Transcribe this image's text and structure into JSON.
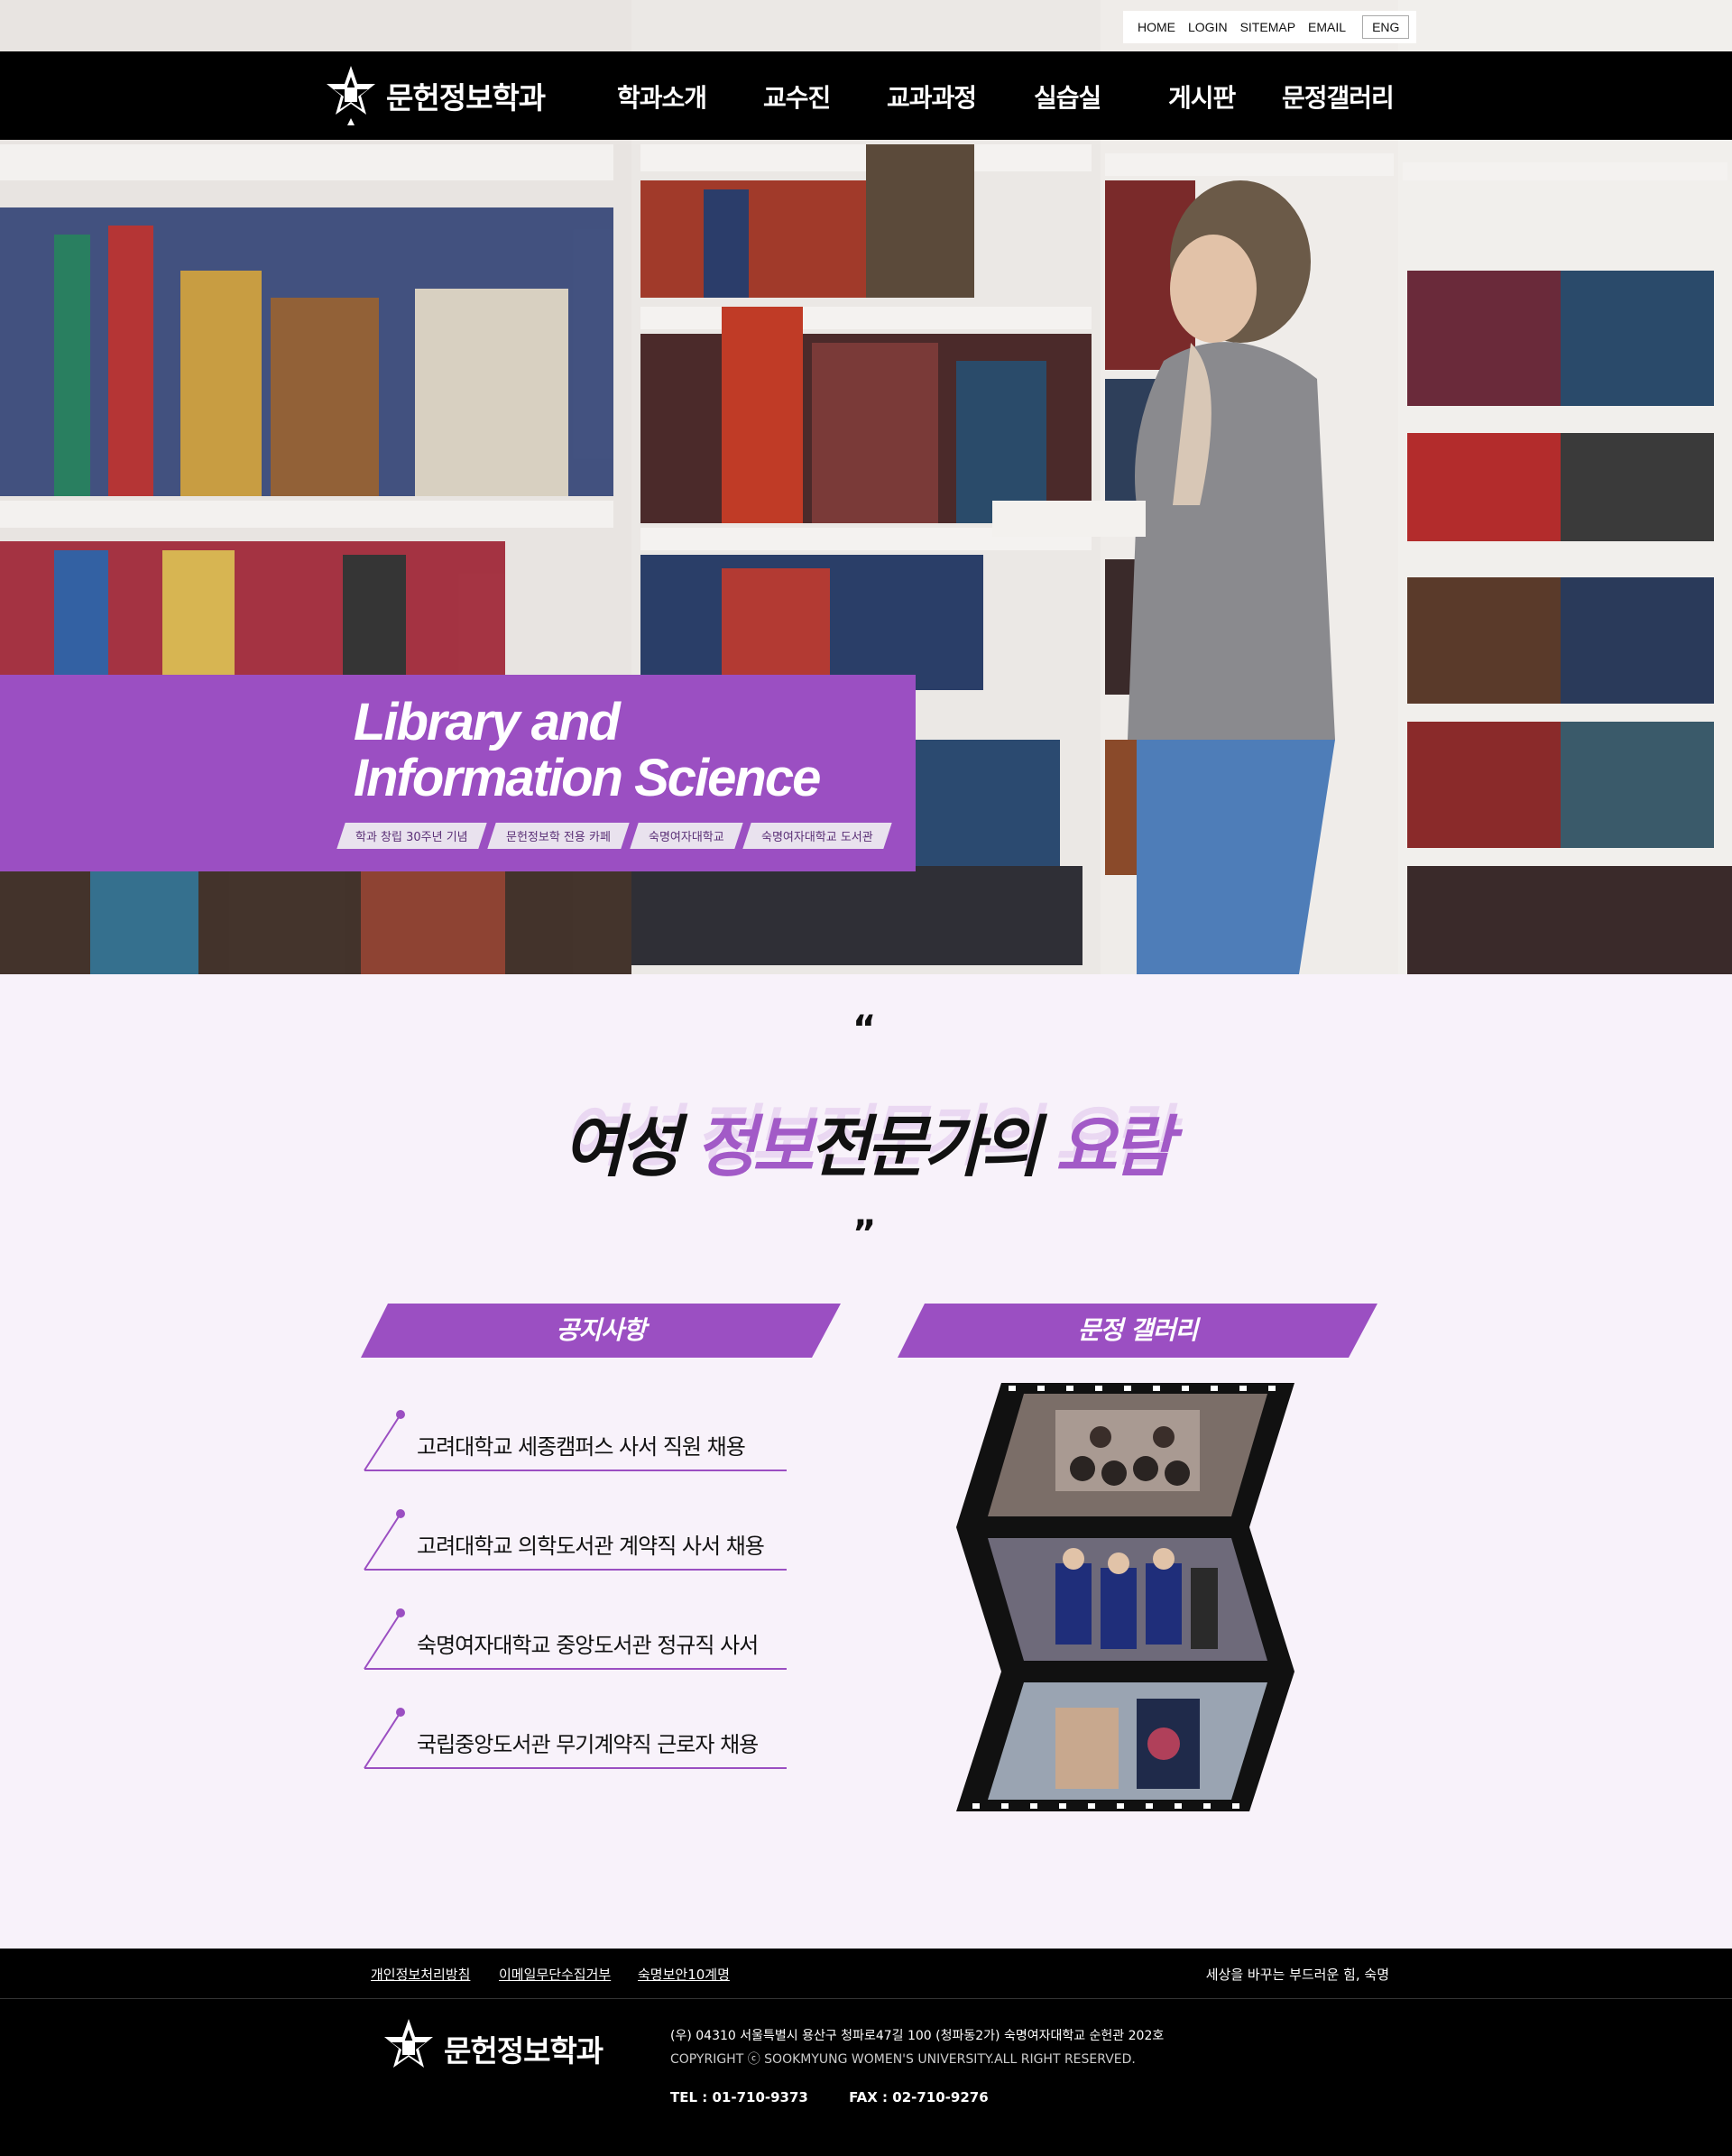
{
  "topbar": {
    "links": [
      "HOME",
      "LOGIN",
      "SITEMAP",
      "EMAIL"
    ],
    "lang": "ENG"
  },
  "nav": {
    "logo": "문헌정보학과",
    "items": [
      "학과소개",
      "교수진",
      "교과과정",
      "실습실",
      "게시판",
      "문정갤러리"
    ]
  },
  "hero": {
    "title_line1": "Library and",
    "title_line2": "Information Science",
    "links": [
      "학과 창립 30주년 기념",
      "문헌정보학 전용 카페",
      "숙명여자대학교",
      "숙명여자대학교 도서관"
    ]
  },
  "slogan": {
    "quote_open": "“",
    "quote_close": "”",
    "part1": "여성 ",
    "part2": "정보",
    "part3": "전문가의 ",
    "part4": "요람"
  },
  "notice": {
    "title": "공지사항",
    "items": [
      "고려대학교 세종캠퍼스 사서 직원 채용",
      "고려대학교 의학도서관 계약직 사서 채용",
      "숙명여자대학교 중앙도서관 정규직 사서",
      "국립중앙도서관 무기계약직 근로자 채용"
    ]
  },
  "gallery": {
    "title": "문정 갤러리"
  },
  "footer": {
    "links": [
      "개인정보처리방침",
      "이메일무단수집거부",
      "숙명보안10계명"
    ],
    "tagline": "세상을 바꾸는 부드러운 힘, 숙명",
    "logo": "문헌정보학과",
    "address": "(우) 04310 서울특별시 용산구 청파로47길 100 (청파동2가) 숙명여자대학교 순헌관 202호",
    "copyright": "COPYRIGHT ⓒ SOOKMYUNG WOMEN'S UNIVERSITY.ALL RIGHT RESERVED.",
    "tel": "TEL  :  01-710-9373",
    "fax": "FAX  :  02-710-9276"
  },
  "colors": {
    "accent": "#9b4fc2",
    "background": "#f8f2fa",
    "nav": "#000000"
  }
}
